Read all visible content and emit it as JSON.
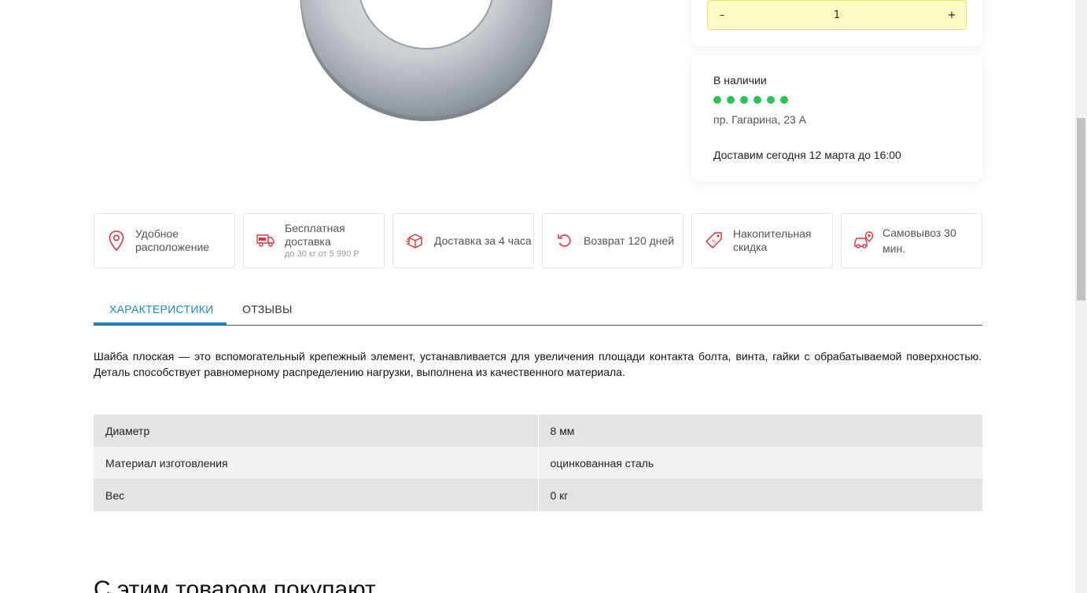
{
  "quantity": {
    "minus_label": "–",
    "value": "1",
    "plus_label": "+"
  },
  "availability": {
    "title": "В наличии",
    "stock_level_dots": 6,
    "address": "пр. Гагарина, 23 А",
    "delivery": "Доставим сегодня 12 марта до 16:00",
    "dot_color": "#2ac356"
  },
  "features": [
    {
      "icon": "location-pin-icon",
      "label": "Удобное расположение"
    },
    {
      "icon": "free-delivery-truck-icon",
      "label": "Бесплатная доставка",
      "sub": "до 30 кг от 5 990 Р"
    },
    {
      "icon": "box-icon",
      "label": "Доставка за 4 часа"
    },
    {
      "icon": "return-arrow-icon",
      "label": "Возврат 120 дней"
    },
    {
      "icon": "discount-tag-icon",
      "label": "Накопительная скидка"
    },
    {
      "icon": "car-pickup-icon",
      "label": "Самовывоз 30 мин."
    }
  ],
  "tabs": [
    {
      "label": "ХАРАКТЕРИСТИКИ",
      "active": true
    },
    {
      "label": "ОТЗЫВЫ",
      "active": false
    }
  ],
  "description": "Шайба плоская — это вспомогательный крепежный элемент, устанавливается для увеличения площади контакта болта, винта, гайки с обрабатываемой поверхностью. Деталь способствует равномерному распределению нагрузки, выполнена из качественного материала.",
  "specs": [
    {
      "name": "Диаметр",
      "value": "8 мм"
    },
    {
      "name": "Материал изготовления",
      "value": "оцинкованная сталь"
    },
    {
      "name": "Вес",
      "value": "0 кг"
    }
  ],
  "related_title": "С этим товаром покупают",
  "colors": {
    "accent": "#1e88c9",
    "icon_red": "#e0343c",
    "qty_bg": "#fdfcc4"
  }
}
